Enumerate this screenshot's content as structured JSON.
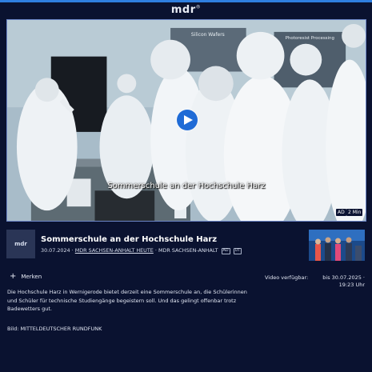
{
  "brand": {
    "logo": "mdr",
    "logo_mark": "®"
  },
  "player": {
    "subtitle": "Sommerschule an der Hochschule Harz",
    "audio_description_badge": "AD",
    "duration_badge": "2 Min",
    "scene_signs": [
      "Silicon Wafers",
      "Photoresist Processing"
    ],
    "play_icon": "play-icon"
  },
  "video": {
    "channel_logo": "mdr",
    "title": "Sommerschule an der Hochschule Harz",
    "date": "30.07.2024",
    "separator": "·",
    "program": "MDR SACHSEN-ANHALT HEUTE",
    "channel": "MDR SACHSEN-ANHALT",
    "badges": [
      "AD",
      "UT"
    ]
  },
  "actions": {
    "bookmark_label": "Merken",
    "bookmark_icon": "plus-icon"
  },
  "availability": {
    "label": "Video verfügbar:",
    "value": "bis 30.07.2025 · 19:23 Uhr"
  },
  "description": "Die Hochschule Harz in Wernigerode bietet derzeit eine Sommerschule an, die Schülerinnen und Schüler für technische Studiengänge begeistern soll. Und das gelingt offenbar trotz Badewetters gut.",
  "credit": "Bild: MITTELDEUTSCHER RUNDFUNK",
  "colors": {
    "background": "#0a1230",
    "accent": "#1f6bd6",
    "topbar": "#2f7fe0"
  }
}
